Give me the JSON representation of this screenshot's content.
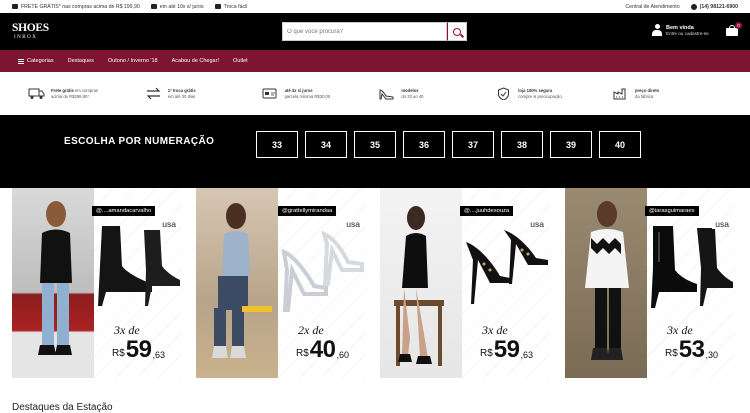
{
  "topbar": {
    "free_shipping": "FRETE GRÁTIS* nas compras acima de R$ 199,90",
    "installments": "em até 10x s/ juros",
    "exchange": "Troca fácil",
    "support": "Central de Atendimento",
    "whatsapp": "(14) 98121-6900"
  },
  "header": {
    "logo_main": "SHOES",
    "logo_sub": "INBOX",
    "search_placeholder": "O que você procura?",
    "user_greeting": "Bem vinda",
    "user_action": "Entre ou cadastre-se",
    "cart_count": "0"
  },
  "nav": {
    "items": [
      "Categorias",
      "Destaques",
      "Outono / Inverno '18",
      "Acabou de Chegar!",
      "Outlet"
    ]
  },
  "benefits": [
    {
      "bold": "Frete grátis",
      "line1": " em compras",
      "line2": "acima de R$299,90*",
      "icon": "truck-icon"
    },
    {
      "bold": "1ª troca grátis",
      "line1": "",
      "line2": "em até 30 dias",
      "icon": "exchange-icon"
    },
    {
      "bold": "até 3x s/ juros",
      "line1": "",
      "line2": "parcela mínima R$30,00",
      "icon": "card-icon"
    },
    {
      "bold": "modelos",
      "line1": "",
      "line2": "do 33 ao 40",
      "icon": "heel-icon"
    },
    {
      "bold": "loja 100% segura",
      "line1": "",
      "line2": "compre si preocupação",
      "icon": "shield-icon"
    },
    {
      "bold": "preço direto",
      "line1": "",
      "line2": "da fábrica",
      "icon": "factory-icon"
    }
  ],
  "sizes": {
    "title": "ESCOLHA POR NUMERAÇÃO",
    "options": [
      "33",
      "34",
      "35",
      "36",
      "37",
      "38",
      "39",
      "40"
    ]
  },
  "banners": [
    {
      "handle": "@....amandacarvalho",
      "tag": "usa",
      "times": "3x de",
      "currency": "R$",
      "price": "59",
      "cents": ",63"
    },
    {
      "handle": "@grattellymirandaa",
      "tag": "usa",
      "times": "2x de",
      "currency": "R$",
      "price": "40",
      "cents": ",60"
    },
    {
      "handle": "@....juuhdesouza",
      "tag": "usa",
      "times": "3x de",
      "currency": "R$",
      "price": "59",
      "cents": ",63"
    },
    {
      "handle": "@iarasguimaraes",
      "tag": "usa",
      "times": "3x de",
      "currency": "R$",
      "price": "53",
      "cents": ",30"
    }
  ],
  "section": {
    "title": "Destaques da Estação"
  },
  "colors": {
    "brand": "#7d1430",
    "header_bg": "#000000"
  }
}
